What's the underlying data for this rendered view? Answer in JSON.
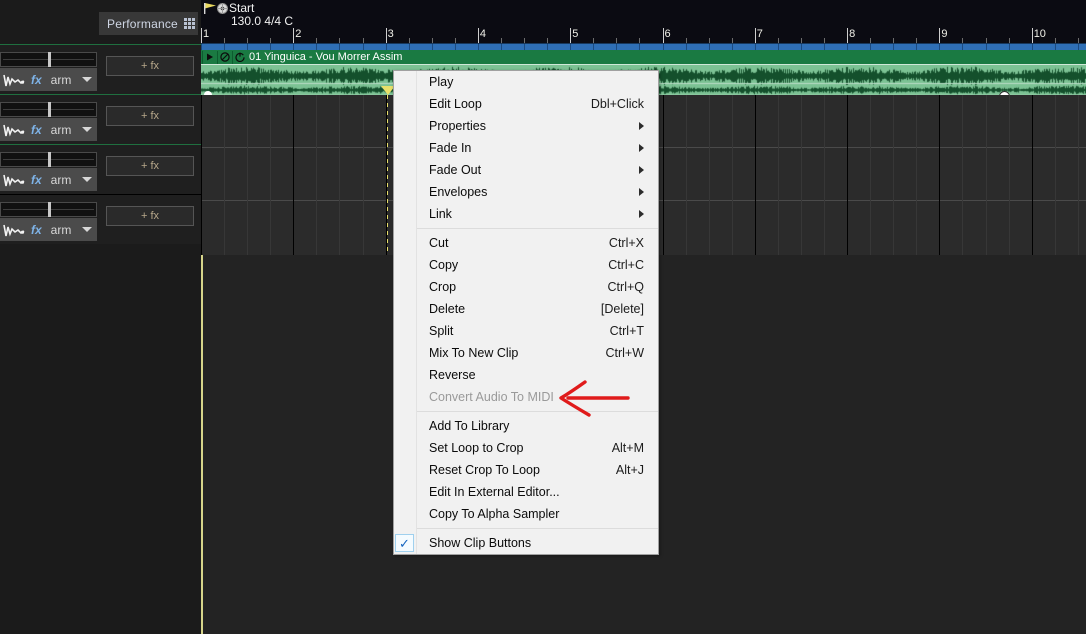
{
  "tabs": {
    "performance_label": "Performance",
    "performance_icon": "grid-icon"
  },
  "transport": {
    "marker_label": "Start",
    "meta": "130.0 4/4 C",
    "tempo": "130.0",
    "time_signature": "4/4",
    "key": "C",
    "flag_icon": "flag-icon",
    "gear_icon": "gear-icon"
  },
  "ruler": {
    "bars": [
      "1",
      "2",
      "3",
      "4",
      "5",
      "6",
      "7",
      "8",
      "9",
      "10"
    ]
  },
  "clip": {
    "title": "01 Yinguica - Vou Morrer Assim",
    "buttons": [
      {
        "name": "clip-play-button",
        "icon": "play-icon"
      },
      {
        "name": "clip-mute-button",
        "icon": "no-entry-icon"
      },
      {
        "name": "clip-loop-button",
        "icon": "loop-icon"
      }
    ],
    "color": "#1a8a4a"
  },
  "tracks": [
    {
      "fx_label": "fx",
      "arm_label": "arm",
      "add_fx_label": "+ fx",
      "wave_icon": "waveform-icon",
      "chevron_icon": "chevron-down-icon"
    },
    {
      "fx_label": "fx",
      "arm_label": "arm",
      "add_fx_label": "+ fx",
      "wave_icon": "waveform-icon",
      "chevron_icon": "chevron-down-icon"
    },
    {
      "fx_label": "fx",
      "arm_label": "arm",
      "add_fx_label": "+ fx",
      "wave_icon": "waveform-icon",
      "chevron_icon": "chevron-down-icon"
    },
    {
      "fx_label": "fx",
      "arm_label": "arm",
      "add_fx_label": "+ fx",
      "wave_icon": "waveform-icon",
      "chevron_icon": "chevron-down-icon"
    }
  ],
  "context_menu": {
    "groups": [
      [
        {
          "label": "Play",
          "accel": "",
          "submenu": false,
          "disabled": false
        },
        {
          "label": "Edit Loop",
          "accel": "Dbl+Click",
          "submenu": false,
          "disabled": false
        },
        {
          "label": "Properties",
          "accel": "",
          "submenu": true,
          "disabled": false
        },
        {
          "label": "Fade In",
          "accel": "",
          "submenu": true,
          "disabled": false
        },
        {
          "label": "Fade Out",
          "accel": "",
          "submenu": true,
          "disabled": false
        },
        {
          "label": "Envelopes",
          "accel": "",
          "submenu": true,
          "disabled": false
        },
        {
          "label": "Link",
          "accel": "",
          "submenu": true,
          "disabled": false
        }
      ],
      [
        {
          "label": "Cut",
          "accel": "Ctrl+X",
          "submenu": false,
          "disabled": false
        },
        {
          "label": "Copy",
          "accel": "Ctrl+C",
          "submenu": false,
          "disabled": false
        },
        {
          "label": "Crop",
          "accel": "Ctrl+Q",
          "submenu": false,
          "disabled": false
        },
        {
          "label": "Delete",
          "accel": "[Delete]",
          "submenu": false,
          "disabled": false
        },
        {
          "label": "Split",
          "accel": "Ctrl+T",
          "submenu": false,
          "disabled": false
        },
        {
          "label": "Mix To New Clip",
          "accel": "Ctrl+W",
          "submenu": false,
          "disabled": false
        },
        {
          "label": "Reverse",
          "accel": "",
          "submenu": false,
          "disabled": false
        },
        {
          "label": "Convert Audio To MIDI",
          "accel": "",
          "submenu": false,
          "disabled": true
        }
      ],
      [
        {
          "label": "Add To Library",
          "accel": "",
          "submenu": false,
          "disabled": false
        },
        {
          "label": "Set Loop to Crop",
          "accel": "Alt+M",
          "submenu": false,
          "disabled": false
        },
        {
          "label": "Reset Crop To Loop",
          "accel": "Alt+J",
          "submenu": false,
          "disabled": false
        },
        {
          "label": "Edit In External Editor...",
          "accel": "",
          "submenu": false,
          "disabled": false
        },
        {
          "label": "Copy To Alpha Sampler",
          "accel": "",
          "submenu": false,
          "disabled": false
        }
      ],
      [
        {
          "label": "Show Clip Buttons",
          "accel": "",
          "submenu": false,
          "disabled": false,
          "checked": true
        }
      ]
    ]
  },
  "annotation": {
    "shape": "arrow-left",
    "color": "#e01b1b",
    "points_at": "Convert Audio To MIDI"
  }
}
